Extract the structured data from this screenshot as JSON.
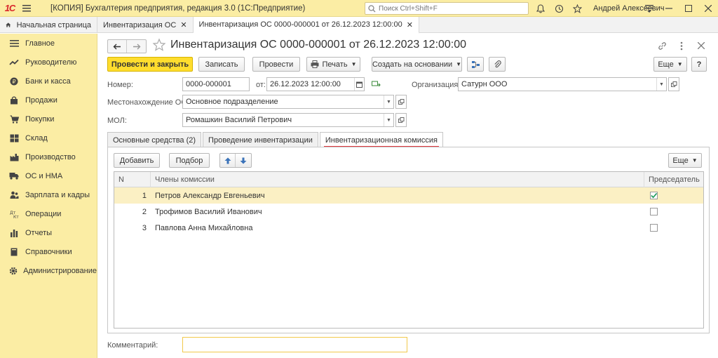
{
  "window": {
    "logo": "1С",
    "title": "[КОПИЯ] Бухгалтерия предприятия, редакция 3.0  (1С:Предприятие)",
    "search_placeholder": "Поиск Ctrl+Shift+F",
    "user": "Андрей Алексеевич"
  },
  "tabs": [
    {
      "label": "Начальная страница"
    },
    {
      "label": "Инвентаризация ОС"
    },
    {
      "label": "Инвентаризация ОС 0000-000001 от 26.12.2023 12:00:00"
    }
  ],
  "sidebar": {
    "items": [
      {
        "label": "Главное",
        "icon": "menu-icon"
      },
      {
        "label": "Руководителю",
        "icon": "chart-trend-icon"
      },
      {
        "label": "Банк и касса",
        "icon": "coin-icon"
      },
      {
        "label": "Продажи",
        "icon": "bag-icon"
      },
      {
        "label": "Покупки",
        "icon": "cart-icon"
      },
      {
        "label": "Склад",
        "icon": "warehouse-icon"
      },
      {
        "label": "Производство",
        "icon": "factory-icon"
      },
      {
        "label": "ОС и НМА",
        "icon": "truck-icon"
      },
      {
        "label": "Зарплата и кадры",
        "icon": "people-icon"
      },
      {
        "label": "Операции",
        "icon": "operations-icon"
      },
      {
        "label": "Отчеты",
        "icon": "bar-chart-icon"
      },
      {
        "label": "Справочники",
        "icon": "book-icon"
      },
      {
        "label": "Администрирование",
        "icon": "gear-icon"
      }
    ]
  },
  "document": {
    "title": "Инвентаризация ОС 0000-000001 от 26.12.2023 12:00:00"
  },
  "toolbar": {
    "post_close": "Провести и закрыть",
    "save": "Записать",
    "post": "Провести",
    "print": "Печать",
    "create_based": "Создать на основании",
    "more": "Еще",
    "help": "?"
  },
  "form": {
    "number_label": "Номер:",
    "number_value": "0000-000001",
    "date_label": "от:",
    "date_value": "26.12.2023 12:00:00",
    "org_label": "Организация:",
    "org_value": "Сатурн ООО",
    "location_label": "Местонахождение ОС:",
    "location_value": "Основное подразделение",
    "mol_label": "МОЛ:",
    "mol_value": "Ромашкин Василий Петрович",
    "comment_label": "Комментарий:",
    "comment_value": ""
  },
  "inner_tabs": [
    {
      "label": "Основные средства (2)"
    },
    {
      "label": "Проведение инвентаризации"
    },
    {
      "label": "Инвентаризационная комиссия"
    }
  ],
  "panel_toolbar": {
    "add": "Добавить",
    "pick": "Подбор",
    "more": "Еще"
  },
  "grid": {
    "columns": [
      "N",
      "Члены комиссии",
      "Председатель"
    ],
    "rows": [
      {
        "n": "1",
        "name": "Петров Александр Евгеньевич",
        "chair": true
      },
      {
        "n": "2",
        "name": "Трофимов Василий Иванович",
        "chair": false
      },
      {
        "n": "3",
        "name": "Павлова Анна Михайловна",
        "chair": false
      }
    ]
  },
  "colors": {
    "sidebar_bg": "#fbeda4",
    "primary_button": "#ffdd2e",
    "active_tab_underline": "#e0393e",
    "selected_row": "#fbf0c4"
  }
}
